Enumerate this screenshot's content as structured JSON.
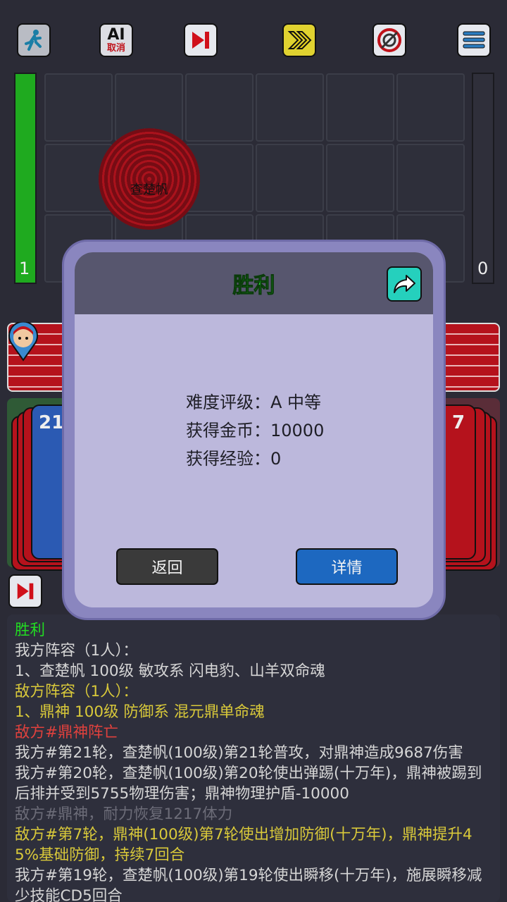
{
  "toolbar": {
    "ai_label": "AI",
    "ai_cancel_label": "取消"
  },
  "battle": {
    "left_count": "1",
    "right_count": "0",
    "unit_name": "查楚帆",
    "left_card_num": "21",
    "right_card_num": "7"
  },
  "dialog": {
    "title": "胜利",
    "difficulty": "难度评级：A 中等",
    "coins": "获得金币：10000",
    "exp": "获得经验：0",
    "back_label": "返回",
    "detail_label": "详情"
  },
  "log": {
    "lines": [
      {
        "text": "胜利",
        "color": "#22dd22"
      },
      {
        "text": "我方阵容（1人）：",
        "color": "#d6d6d6"
      },
      {
        "text": "1、查楚帆 100级 敏攻系 闪电豹、山羊双命魂",
        "color": "#d6d6d6"
      },
      {
        "text": "敌方阵容（1人）：",
        "color": "#d9c93a"
      },
      {
        "text": "1、鼎神 100级 防御系 混元鼎单命魂",
        "color": "#d9c93a"
      },
      {
        "text": "敌方#鼎神阵亡",
        "color": "#e0413d"
      },
      {
        "text": "我方#第21轮，查楚帆(100级)第21轮普攻，对鼎神造成9687伤害",
        "color": "#d6d6d6"
      },
      {
        "text": "我方#第20轮，查楚帆(100级)第20轮使出弹踢(十万年)，鼎神被踢到后排并受到5755物理伤害；鼎神物理护盾-10000",
        "color": "#d6d6d6"
      },
      {
        "text": "敌方#鼎神，耐力恢复1217体力",
        "color": "#6c6c78"
      },
      {
        "text": "敌方#第7轮，鼎神(100级)第7轮使出增加防御(十万年)，鼎神提升45%基础防御，持续7回合",
        "color": "#d9c93a"
      },
      {
        "text": "我方#第19轮，查楚帆(100级)第19轮使出瞬移(十万年)，施展瞬移减少技能CD5回合",
        "color": "#d6d6d6"
      }
    ]
  },
  "colors": {
    "accent_green": "#2ce83a",
    "detail_blue": "#1d68c0",
    "hp_green": "#1faa1f"
  }
}
